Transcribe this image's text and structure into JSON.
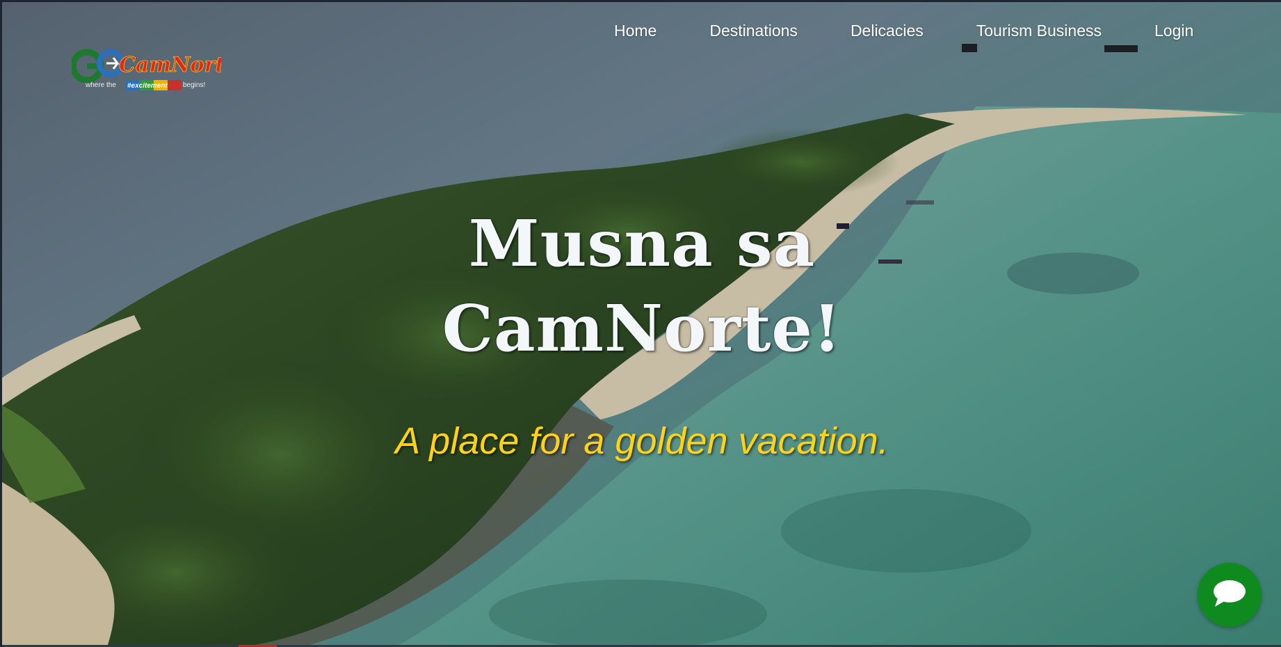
{
  "logo": {
    "brand_text": "GoCamNorte",
    "tagline": "where the #excitement begins!"
  },
  "nav": {
    "items": [
      {
        "label": "Home"
      },
      {
        "label": "Destinations"
      },
      {
        "label": "Delicacies"
      },
      {
        "label": "Tourism Business"
      },
      {
        "label": "Login"
      }
    ]
  },
  "hero": {
    "headline_line1": "Musna sa",
    "headline_line2": "CamNorte!",
    "tagline": "A place for a golden vacation."
  },
  "chat": {
    "icon": "chat-bubble-icon"
  },
  "colors": {
    "tagline": "#ffd21a",
    "chat_button": "#0f8a1f",
    "headline": "#f4f7fa"
  }
}
